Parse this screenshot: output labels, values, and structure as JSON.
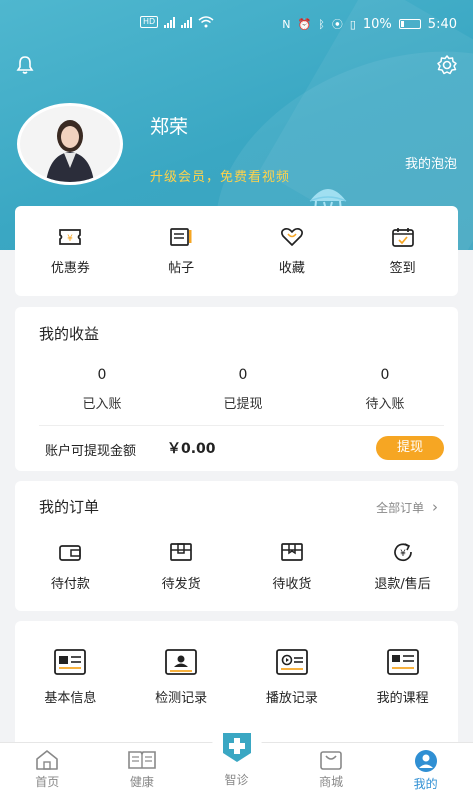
{
  "status_bar": {
    "left_icons": [
      "hd-icon",
      "signal-icon",
      "signal-icon",
      "wifi-icon"
    ],
    "battery": "10%",
    "time": "5:40"
  },
  "profile": {
    "name": "郑荣",
    "upgrade_text": "升级会员，免费看视频",
    "bubble_link": "我的泡泡"
  },
  "quick_actions": [
    {
      "label": "优惠券",
      "icon": "coupon-icon"
    },
    {
      "label": "帖子",
      "icon": "post-icon"
    },
    {
      "label": "收藏",
      "icon": "heart-icon"
    },
    {
      "label": "签到",
      "icon": "calendar-check-icon"
    }
  ],
  "earnings": {
    "title": "我的收益",
    "items": [
      {
        "value": "0",
        "label": "已入账"
      },
      {
        "value": "0",
        "label": "已提现"
      },
      {
        "value": "0",
        "label": "待入账"
      }
    ],
    "withdrawable_label": "账户可提现金额",
    "withdrawable_amount": "￥0.00",
    "withdraw_button": "提现"
  },
  "orders": {
    "title": "我的订单",
    "all_orders_link": "全部订单",
    "items": [
      {
        "label": "待付款",
        "icon": "wallet-icon"
      },
      {
        "label": "待发货",
        "icon": "box-icon"
      },
      {
        "label": "待收货",
        "icon": "package-icon"
      },
      {
        "label": "退款/售后",
        "icon": "refund-icon"
      }
    ]
  },
  "services": {
    "items": [
      {
        "label": "基本信息",
        "icon": "id-card-icon"
      },
      {
        "label": "检测记录",
        "icon": "test-record-icon"
      },
      {
        "label": "播放记录",
        "icon": "play-record-icon"
      },
      {
        "label": "我的课程",
        "icon": "course-icon"
      }
    ]
  },
  "tabbar": {
    "items": [
      {
        "label": "首页",
        "icon": "home-icon"
      },
      {
        "label": "健康",
        "icon": "book-icon"
      },
      {
        "label": "智诊",
        "icon": "medical-plus-icon"
      },
      {
        "label": "商城",
        "icon": "shop-bag-icon"
      },
      {
        "label": "我的",
        "icon": "profile-icon"
      }
    ],
    "active": "我的"
  },
  "colors": {
    "header": "#3aa7c3",
    "accent_orange": "#f6a623",
    "upgrade_yellow": "#ffd24a",
    "active_tab": "#2f8fd3"
  }
}
